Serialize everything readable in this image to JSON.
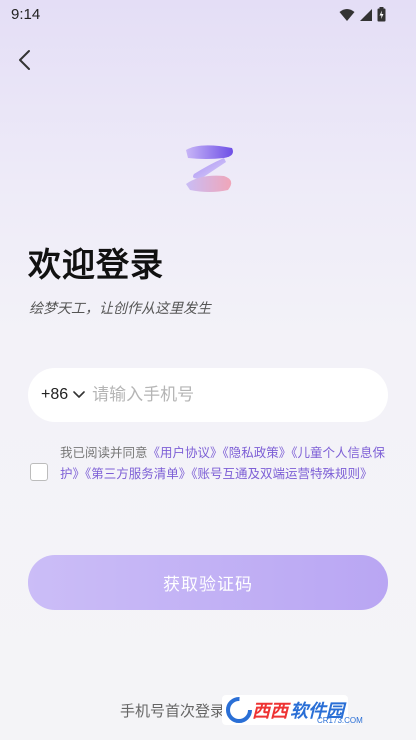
{
  "status_bar": {
    "time": "9:14"
  },
  "header": {
    "back_icon": "chevron-left-icon"
  },
  "logo": {
    "icon": "app-logo-icon",
    "colors": [
      "#7b5ee8",
      "#c7b4f6",
      "#f0a6b9"
    ]
  },
  "title": "欢迎登录",
  "subtitle": "绘梦天工，让创作从这里发生",
  "phone": {
    "country_code": "+86",
    "placeholder": "请输入手机号",
    "value": ""
  },
  "agreement": {
    "checked": false,
    "prefix": "我已阅读并同意",
    "links": [
      "《用户协议》",
      "《隐私政策》",
      "《儿童个人信息保护》",
      "《第三方服务清单》",
      "《账号互通及双端运营特殊规则》"
    ]
  },
  "submit_label": "获取验证码",
  "bottom_note": "手机号首次登录",
  "watermark": {
    "brand_red": "西西",
    "brand_blue": "软件园",
    "domain": "CR173.COM"
  },
  "colors": {
    "accent": "#7d5fd6",
    "button_start": "#cbbdf7",
    "button_end": "#b9a6f3"
  }
}
